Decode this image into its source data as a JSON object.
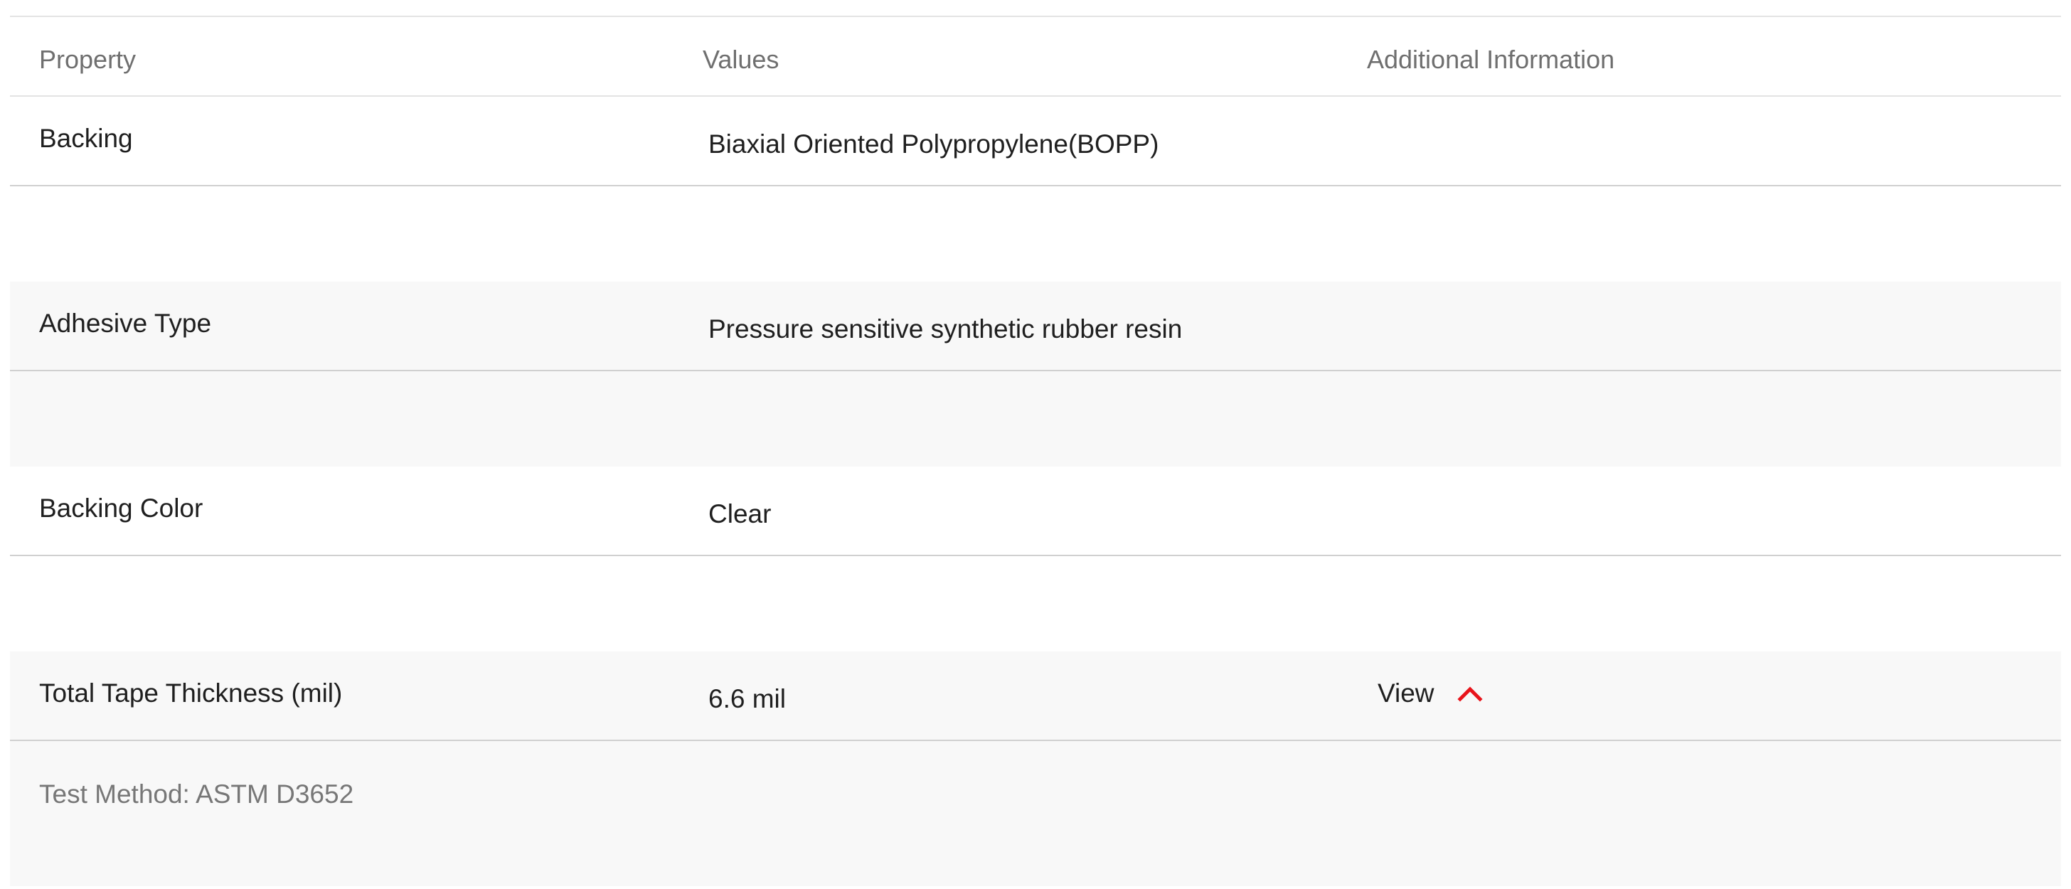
{
  "header": {
    "property": "Property",
    "values": "Values",
    "additional": "Additional Information"
  },
  "rows": [
    {
      "property": "Backing",
      "value": "Biaxial Oriented Polypropylene(BOPP)"
    },
    {
      "property": "Adhesive Type",
      "value": "Pressure sensitive synthetic rubber resin"
    },
    {
      "property": "Backing Color",
      "value": "Clear"
    },
    {
      "property": "Total Tape Thickness (mil)",
      "value": "6.6 mil",
      "additional_link": "View",
      "expanded": true
    }
  ],
  "detail": {
    "test_method": "Test Method: ASTM D3652"
  },
  "colors": {
    "accent": "#e8141b",
    "shade": "#f8f8f8",
    "border": "#d0d0d0"
  },
  "icons": {
    "toggle": "chevron-up-icon"
  }
}
